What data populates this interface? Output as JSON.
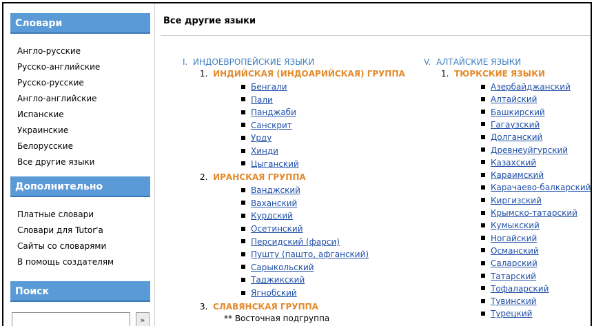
{
  "sidebar": {
    "dictionaries_title": "Словари",
    "dictionaries": [
      "Англо-русские",
      "Русско-английские",
      "Русско-русские",
      "Англо-английские",
      "Испанские",
      "Украинские",
      "Белорусские",
      "Все другие языки"
    ],
    "extra_title": "Дополнительно",
    "extra": [
      "Платные словари",
      "Словари для Tutor'a",
      "Сайты со словарями",
      "В помощь создателям"
    ],
    "search_title": "Поиск",
    "search_value": "",
    "search_button": "»"
  },
  "main": {
    "title": "Все другие языки",
    "left": {
      "family_num": "I.",
      "family_name": "ИНДОЕВРОПЕЙСКИЕ ЯЗЫКИ",
      "groups": [
        {
          "num": "1.",
          "name": "ИНДИЙСКАЯ (ИНДОАРИЙСКАЯ) ГРУППА",
          "langs": [
            "Бенгали",
            "Пали",
            "Панджаби",
            "Санскрит",
            "Урду",
            "Хинди",
            "Цыганский"
          ]
        },
        {
          "num": "2.",
          "name": "ИРАНСКАЯ ГРУППА",
          "langs": [
            "Ванджский",
            "Ваханский",
            "Курдский",
            "Осетинский",
            "Персидский (фарси)",
            "Пушту (пашто, афганский)",
            "Сарыкольский",
            "Таджикский",
            "Ягнобский"
          ]
        },
        {
          "num": "3.",
          "name": "СЛАВЯНСКАЯ ГРУППА",
          "langs": []
        }
      ],
      "subgroup": "** Восточная подгруппа"
    },
    "right": {
      "family_num": "V.",
      "family_name": "АЛТАЙСКИЕ ЯЗЫКИ",
      "group_num": "1.",
      "group_name": "ТЮРКСКИЕ ЯЗЫКИ",
      "langs": [
        "Азербайджанский",
        "Алтайский",
        "Башкирский",
        "Гагаузский",
        "Долганский",
        "Древнеуйгурский",
        "Казахский",
        "Караимский",
        "Карачаево-балкарский",
        "Киргизский",
        "Крымско-татарский",
        "Кумыкский",
        "Ногайский",
        "Османский",
        "Саларский",
        "Татарский",
        "Тофаларский",
        "Тувинский",
        "Турецкий"
      ]
    }
  }
}
